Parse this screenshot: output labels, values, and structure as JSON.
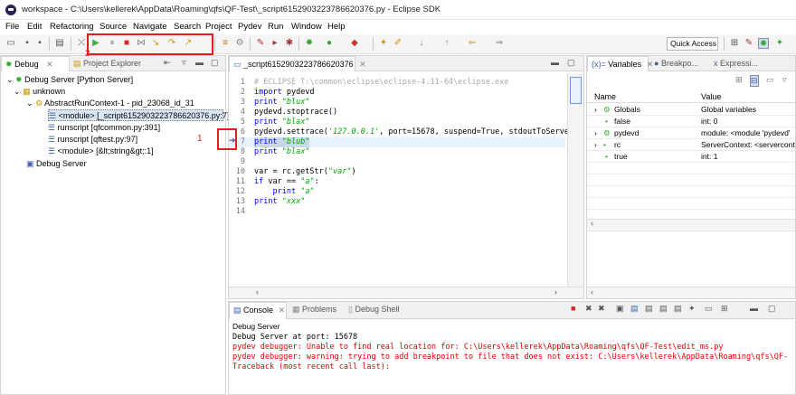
{
  "window": {
    "title": "workspace - C:\\Users\\kellerek\\AppData\\Roaming\\qfs\\QF-Test\\_script6152903223786620376.py - Eclipse SDK"
  },
  "menu": [
    "File",
    "Edit",
    "Refactoring",
    "Source",
    "Navigate",
    "Search",
    "Project",
    "Pydev",
    "Run",
    "Window",
    "Help"
  ],
  "toolbar": {
    "quick_access": "Quick Access"
  },
  "debug_view": {
    "tabs": [
      "Debug",
      "Project Explorer"
    ],
    "tree": [
      "Debug Server [Python Server]",
      "unknown",
      "AbstractRunContext-1 - pid_23068_id_31",
      "<module> [_script6152903223786620376.py:7]",
      "runscript [qfcommon.py:391]",
      "runscript [qftest.py:97]",
      "<module> [&lt;string&gt;:1]",
      "Debug Server"
    ]
  },
  "editor": {
    "tab": "_script6152903223786620376",
    "lines": [
      "# ECLIPSE T:\\common\\eclipse\\eclipse-4.11-64\\eclipse.exe",
      "import pydevd",
      "print \"blux\"",
      "pydevd.stoptrace()",
      "print \"blax\"",
      "pydevd.settrace('127.0.0.1', port=15678, suspend=True, stdoutToServer",
      "print \"blub\"",
      "print \"blax\"",
      "",
      "var = rc.getStr(\"var\")",
      "if var == \"a\":",
      "    print \"a\"",
      "print \"xxx\"",
      ""
    ],
    "current_line": 7
  },
  "variables_view": {
    "tabs": [
      "Variables",
      "Breakpo...",
      "Expressi..."
    ],
    "columns": [
      "Name",
      "Value"
    ],
    "rows": [
      {
        "name": "Globals",
        "value": "Global variables"
      },
      {
        "name": "false",
        "value": "int: 0"
      },
      {
        "name": "pydevd",
        "value": "module: <module 'pydevd'"
      },
      {
        "name": "rc",
        "value": "ServerContext: <servercont"
      },
      {
        "name": "true",
        "value": "int: 1"
      }
    ]
  },
  "console_view": {
    "tabs": [
      "Console",
      "Problems",
      "Debug Shell"
    ],
    "header": "Debug Server",
    "lines": [
      {
        "text": "Debug Server at port: 15678",
        "color": "#000000"
      },
      {
        "text": "pydev debugger: Unable to find real location for: C:\\Users\\kellerek\\AppData\\Roaming\\qfs\\QF-Test\\edit_ms.py",
        "color": "#e00000"
      },
      {
        "text": "pydev debugger: warning: trying to add breakpoint to file that does not exist: C:\\Users\\kellerek\\AppData\\Roaming\\qfs\\QF-",
        "color": "#e00000"
      },
      {
        "text": "Traceback (most recent call last):",
        "color": "#e00000"
      }
    ]
  },
  "annotations": [
    "1",
    "2"
  ],
  "colors": {
    "accent_red": "#e02020",
    "selection": "#d9e6f3",
    "current_line": "#e8f2fe"
  }
}
